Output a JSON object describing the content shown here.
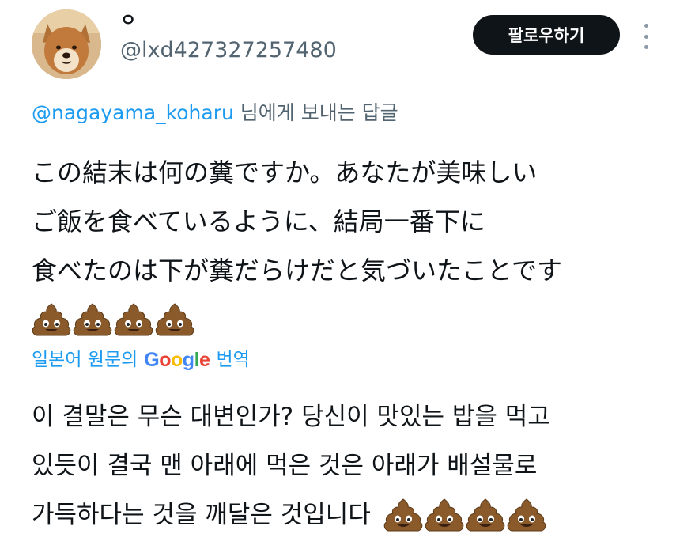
{
  "tweet": {
    "display_name": "ㅇ",
    "handle": "@lxd427327257480",
    "follow_label": "팔로우하기",
    "reply_to_handle": "@nagayama_koharu",
    "reply_to_suffix": " 님에게 보내는 답글",
    "original_lines": [
      "この結末は何の糞ですか。あなたが美味しい",
      "ご飯を食べているように、結局一番下に",
      "食べたのは下が糞だらけだと気づいたことです"
    ],
    "emoji": "💩💩💩💩",
    "translate_prefix": "일본어 원문의",
    "translate_brand": "Google",
    "translate_suffix": "번역",
    "translated_lines": [
      "이 결말은 무슨 대변인가? 당신이 맛있는 밥을 먹고",
      "있듯이 결국 맨 아래에 먹은 것은 아래가 배설물로",
      "가득하다는 것을 깨달은 것입니다"
    ]
  },
  "colors": {
    "accent": "#1d9bf0",
    "secondary_text": "#536471",
    "follow_bg": "#0f1419"
  }
}
